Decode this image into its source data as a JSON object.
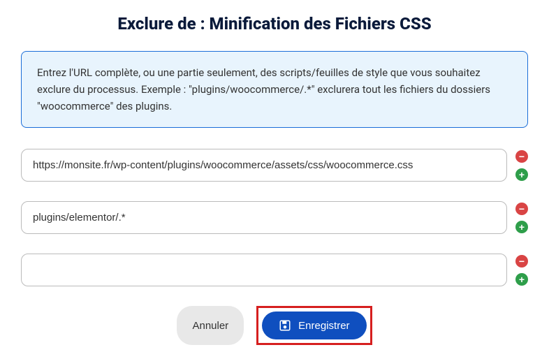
{
  "title": "Exclure de : Minification des Fichiers CSS",
  "info": "Entrez l'URL complète, ou une partie seulement, des scripts/feuilles de style que vous souhaitez exclure du processus. Exemple : \"plugins/woocommerce/.*\" exclurera tout les fichiers du dossiers \"woocommerce\" des plugins.",
  "fields": [
    {
      "value": "https://monsite.fr/wp-content/plugins/woocommerce/assets/css/woocommerce.css"
    },
    {
      "value": "plugins/elementor/.*"
    },
    {
      "value": ""
    }
  ],
  "buttons": {
    "cancel": "Annuler",
    "save": "Enregistrer"
  },
  "icons": {
    "minus": "−",
    "plus": "+"
  }
}
